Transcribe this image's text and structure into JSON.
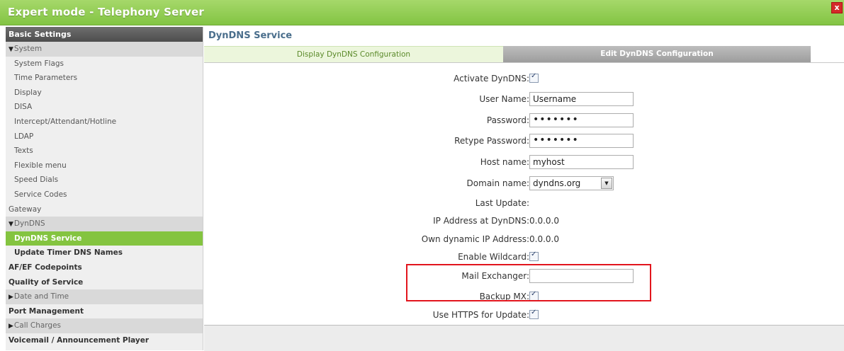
{
  "window": {
    "title": "Expert mode - Telephony Server",
    "close_label": "x"
  },
  "sidebar": {
    "header": "Basic Settings",
    "items": [
      {
        "label": "System"
      },
      {
        "label": "System Flags"
      },
      {
        "label": "Time Parameters"
      },
      {
        "label": "Display"
      },
      {
        "label": "DISA"
      },
      {
        "label": "Intercept/Attendant/Hotline"
      },
      {
        "label": "LDAP"
      },
      {
        "label": "Texts"
      },
      {
        "label": "Flexible menu"
      },
      {
        "label": "Speed Dials"
      },
      {
        "label": "Service Codes"
      },
      {
        "label": "Gateway"
      },
      {
        "label": "DynDNS"
      },
      {
        "label": "DynDNS Service"
      },
      {
        "label": "Update Timer DNS Names"
      },
      {
        "label": "AF/EF Codepoints"
      },
      {
        "label": "Quality of Service"
      },
      {
        "label": "Date and Time"
      },
      {
        "label": "Port Management"
      },
      {
        "label": "Call Charges"
      },
      {
        "label": "Voicemail / Announcement Player"
      }
    ]
  },
  "main": {
    "title": "DynDNS Service",
    "tabs": [
      {
        "label": "Display DynDNS Configuration"
      },
      {
        "label": "Edit DynDNS Configuration"
      }
    ]
  },
  "form": {
    "activate": {
      "label": "Activate DynDNS:",
      "checked": true
    },
    "username": {
      "label": "User Name:",
      "value": "Username"
    },
    "password": {
      "label": "Password:",
      "value": "•••••••"
    },
    "retype": {
      "label": "Retype Password:",
      "value": "•••••••"
    },
    "hostname": {
      "label": "Host name:",
      "value": "myhost"
    },
    "domain": {
      "label": "Domain name:",
      "value": "dyndns.org"
    },
    "last_update": {
      "label": "Last Update:",
      "value": ""
    },
    "ip_dyndns": {
      "label": "IP Address at DynDNS:",
      "value": "0.0.0.0"
    },
    "own_ip": {
      "label": "Own dynamic IP Address:",
      "value": "0.0.0.0"
    },
    "wildcard": {
      "label": "Enable Wildcard:",
      "checked": true
    },
    "mail_exchanger": {
      "label": "Mail Exchanger:",
      "value": ""
    },
    "backup_mx": {
      "label": "Backup MX:",
      "checked": true
    },
    "https": {
      "label": "Use HTTPS for Update:",
      "checked": true
    }
  },
  "colors": {
    "accent": "#84c440",
    "highlight": "#e2151d",
    "title_text": "#4a6e8c"
  }
}
